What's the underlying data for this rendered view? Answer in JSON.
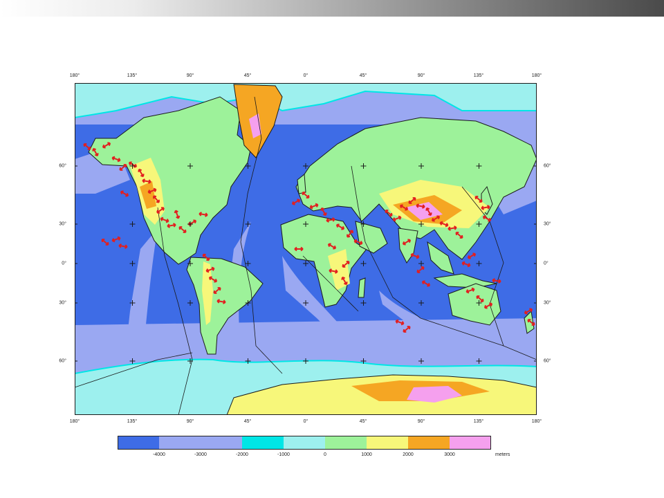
{
  "map": {
    "lon_labels": [
      "180°",
      "135°",
      "90°",
      "45°",
      "0°",
      "45°",
      "90°",
      "135°",
      "180°"
    ],
    "lat_labels": [
      "60°",
      "30°",
      "0°",
      "30°",
      "60°"
    ],
    "lon_values": [
      -180,
      -135,
      -90,
      -45,
      0,
      45,
      90,
      135,
      180
    ],
    "lat_values": [
      60,
      30,
      0,
      -30,
      -60
    ],
    "colors": {
      "deep": "#3e6ce6",
      "ocean2": "#9aa8f2",
      "shelf": "#00e6e6",
      "shallow": "#9df0ee",
      "low": "#9df29a",
      "mid": "#f7f77a",
      "high": "#f5a623",
      "peak": "#f5a0ee",
      "arrow": "#e21f1f",
      "coast": "#1a1a1a"
    }
  },
  "legend": {
    "ticks": [
      "-4000",
      "-3000",
      "-2000",
      "-1000",
      "0",
      "1000",
      "2000",
      "3000"
    ],
    "units": "meters",
    "colors": [
      "#3e6ce6",
      "#9aa8f2",
      "#00e6e6",
      "#9df0ee",
      "#9df29a",
      "#f7f77a",
      "#f5a623",
      "#f5a0ee"
    ]
  }
}
